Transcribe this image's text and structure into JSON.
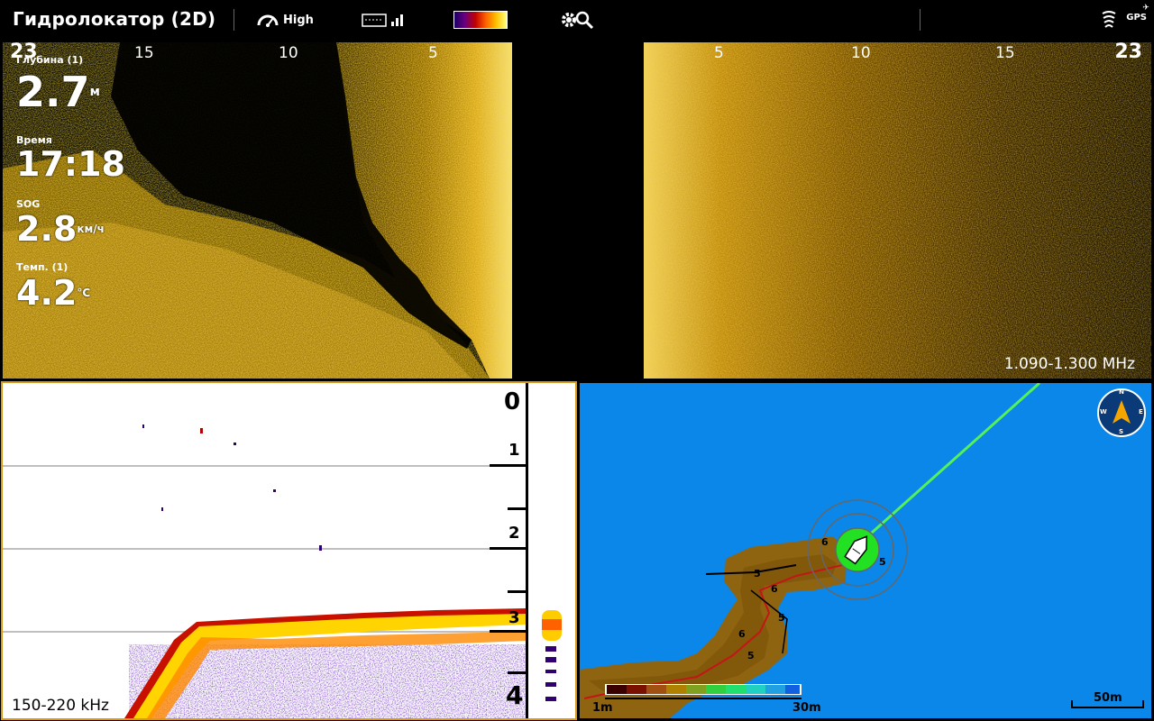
{
  "topbar": {
    "title": "Гидролокатор (2D)",
    "sensitivity_label": "High",
    "gps_label": "GPS"
  },
  "side_imaging_left": {
    "range_max": "23",
    "tick_labels": [
      "15",
      "10",
      "5"
    ]
  },
  "side_imaging_right": {
    "range_max": "23",
    "tick_labels": [
      "5",
      "10",
      "15"
    ],
    "frequency": "1.090-1.300 MHz"
  },
  "data_overlay": {
    "depth": {
      "label": "Глубина (1)",
      "value": "2.7",
      "unit": "м"
    },
    "time": {
      "label": "Время",
      "value": "17:18"
    },
    "sog": {
      "label": "SOG",
      "value": "2.8",
      "unit": "км/ч"
    },
    "temp": {
      "label": "Темп. (1)",
      "value": "4.2",
      "unit": "°C"
    }
  },
  "sonar_2d": {
    "depth_labels": [
      "0",
      "1",
      "2",
      "3",
      "4"
    ],
    "frequency": "150-220 kHz"
  },
  "map": {
    "compass_letters": {
      "n": "N",
      "e": "E",
      "s": "S",
      "w": "W"
    },
    "depth_scale_min": "1m",
    "depth_scale_max": "30m",
    "scale_bar": "50m",
    "contour_labels": [
      "5",
      "6",
      "5",
      "6",
      "5",
      "6",
      "5"
    ]
  },
  "colors": {
    "accent_border": "#d89a1e",
    "water": "#0a87e8",
    "track": "#6ef06e",
    "sonar_gold": "#e8b000"
  }
}
